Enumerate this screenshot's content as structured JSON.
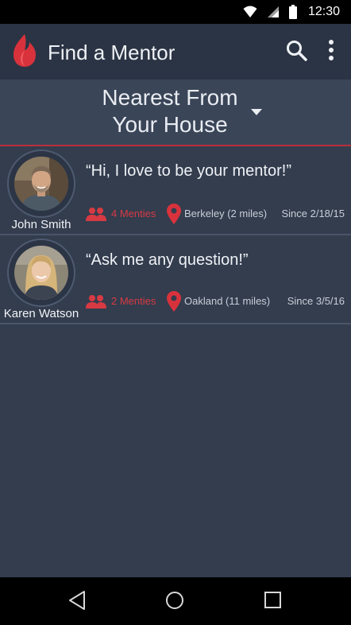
{
  "status_bar": {
    "time": "12:30",
    "icons": [
      "wifi-icon",
      "cell-signal-icon",
      "battery-icon"
    ]
  },
  "app_bar": {
    "title": "Find a Mentor",
    "logo": "flame-logo",
    "actions": [
      "search-icon",
      "more-vert-icon"
    ]
  },
  "filter": {
    "line1": "Nearest From",
    "line2": "Your House",
    "caret": "chevron-down-icon"
  },
  "mentors": [
    {
      "name": "John Smith",
      "quote": "“Hi, I love to be your mentor!”",
      "menties": "4 Menties",
      "place": "Berkeley (2 miles)",
      "since": "Since  2/18/15"
    },
    {
      "name": "Karen Watson",
      "quote": "“Ask me any question!”",
      "menties": "2 Menties",
      "place": "Oakland (11 miles)",
      "since": "Since  3/5/16"
    }
  ],
  "nav_bar": {
    "buttons": [
      "back-icon",
      "home-icon",
      "recents-icon"
    ]
  },
  "colors": {
    "accent": "#d83a43",
    "background": "#333d4e",
    "app_bar": "#2b3444"
  }
}
